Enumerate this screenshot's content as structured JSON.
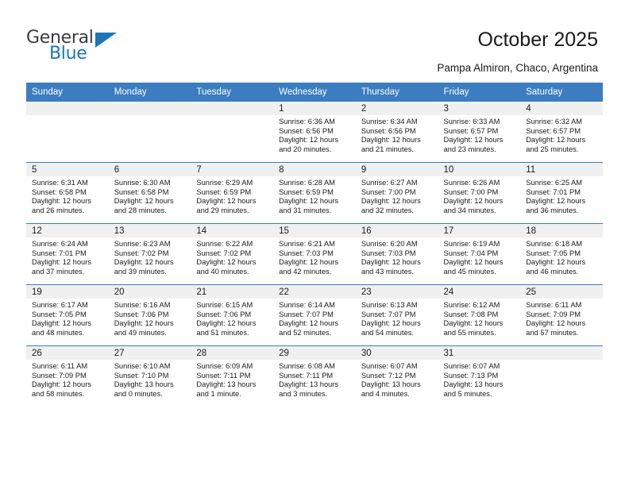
{
  "brand": {
    "name_part1": "General",
    "name_part2": "Blue",
    "accent_color": "#1b75bb"
  },
  "header": {
    "title": "October 2025",
    "subtitle": "Pampa Almiron, Chaco, Argentina"
  },
  "calendar": {
    "header_bg": "#3b7dc0",
    "daynum_bg": "#f0f0f0",
    "weekdays": [
      "Sunday",
      "Monday",
      "Tuesday",
      "Wednesday",
      "Thursday",
      "Friday",
      "Saturday"
    ],
    "weeks": [
      [
        {
          "day": "",
          "empty": true
        },
        {
          "day": "",
          "empty": true
        },
        {
          "day": "",
          "empty": true
        },
        {
          "day": "1",
          "sunrise": "Sunrise: 6:36 AM",
          "sunset": "Sunset: 6:56 PM",
          "daylight_line1": "Daylight: 12 hours",
          "daylight_line2": "and 20 minutes."
        },
        {
          "day": "2",
          "sunrise": "Sunrise: 6:34 AM",
          "sunset": "Sunset: 6:56 PM",
          "daylight_line1": "Daylight: 12 hours",
          "daylight_line2": "and 21 minutes."
        },
        {
          "day": "3",
          "sunrise": "Sunrise: 6:33 AM",
          "sunset": "Sunset: 6:57 PM",
          "daylight_line1": "Daylight: 12 hours",
          "daylight_line2": "and 23 minutes."
        },
        {
          "day": "4",
          "sunrise": "Sunrise: 6:32 AM",
          "sunset": "Sunset: 6:57 PM",
          "daylight_line1": "Daylight: 12 hours",
          "daylight_line2": "and 25 minutes."
        }
      ],
      [
        {
          "day": "5",
          "sunrise": "Sunrise: 6:31 AM",
          "sunset": "Sunset: 6:58 PM",
          "daylight_line1": "Daylight: 12 hours",
          "daylight_line2": "and 26 minutes."
        },
        {
          "day": "6",
          "sunrise": "Sunrise: 6:30 AM",
          "sunset": "Sunset: 6:58 PM",
          "daylight_line1": "Daylight: 12 hours",
          "daylight_line2": "and 28 minutes."
        },
        {
          "day": "7",
          "sunrise": "Sunrise: 6:29 AM",
          "sunset": "Sunset: 6:59 PM",
          "daylight_line1": "Daylight: 12 hours",
          "daylight_line2": "and 29 minutes."
        },
        {
          "day": "8",
          "sunrise": "Sunrise: 6:28 AM",
          "sunset": "Sunset: 6:59 PM",
          "daylight_line1": "Daylight: 12 hours",
          "daylight_line2": "and 31 minutes."
        },
        {
          "day": "9",
          "sunrise": "Sunrise: 6:27 AM",
          "sunset": "Sunset: 7:00 PM",
          "daylight_line1": "Daylight: 12 hours",
          "daylight_line2": "and 32 minutes."
        },
        {
          "day": "10",
          "sunrise": "Sunrise: 6:26 AM",
          "sunset": "Sunset: 7:00 PM",
          "daylight_line1": "Daylight: 12 hours",
          "daylight_line2": "and 34 minutes."
        },
        {
          "day": "11",
          "sunrise": "Sunrise: 6:25 AM",
          "sunset": "Sunset: 7:01 PM",
          "daylight_line1": "Daylight: 12 hours",
          "daylight_line2": "and 36 minutes."
        }
      ],
      [
        {
          "day": "12",
          "sunrise": "Sunrise: 6:24 AM",
          "sunset": "Sunset: 7:01 PM",
          "daylight_line1": "Daylight: 12 hours",
          "daylight_line2": "and 37 minutes."
        },
        {
          "day": "13",
          "sunrise": "Sunrise: 6:23 AM",
          "sunset": "Sunset: 7:02 PM",
          "daylight_line1": "Daylight: 12 hours",
          "daylight_line2": "and 39 minutes."
        },
        {
          "day": "14",
          "sunrise": "Sunrise: 6:22 AM",
          "sunset": "Sunset: 7:02 PM",
          "daylight_line1": "Daylight: 12 hours",
          "daylight_line2": "and 40 minutes."
        },
        {
          "day": "15",
          "sunrise": "Sunrise: 6:21 AM",
          "sunset": "Sunset: 7:03 PM",
          "daylight_line1": "Daylight: 12 hours",
          "daylight_line2": "and 42 minutes."
        },
        {
          "day": "16",
          "sunrise": "Sunrise: 6:20 AM",
          "sunset": "Sunset: 7:03 PM",
          "daylight_line1": "Daylight: 12 hours",
          "daylight_line2": "and 43 minutes."
        },
        {
          "day": "17",
          "sunrise": "Sunrise: 6:19 AM",
          "sunset": "Sunset: 7:04 PM",
          "daylight_line1": "Daylight: 12 hours",
          "daylight_line2": "and 45 minutes."
        },
        {
          "day": "18",
          "sunrise": "Sunrise: 6:18 AM",
          "sunset": "Sunset: 7:05 PM",
          "daylight_line1": "Daylight: 12 hours",
          "daylight_line2": "and 46 minutes."
        }
      ],
      [
        {
          "day": "19",
          "sunrise": "Sunrise: 6:17 AM",
          "sunset": "Sunset: 7:05 PM",
          "daylight_line1": "Daylight: 12 hours",
          "daylight_line2": "and 48 minutes."
        },
        {
          "day": "20",
          "sunrise": "Sunrise: 6:16 AM",
          "sunset": "Sunset: 7:06 PM",
          "daylight_line1": "Daylight: 12 hours",
          "daylight_line2": "and 49 minutes."
        },
        {
          "day": "21",
          "sunrise": "Sunrise: 6:15 AM",
          "sunset": "Sunset: 7:06 PM",
          "daylight_line1": "Daylight: 12 hours",
          "daylight_line2": "and 51 minutes."
        },
        {
          "day": "22",
          "sunrise": "Sunrise: 6:14 AM",
          "sunset": "Sunset: 7:07 PM",
          "daylight_line1": "Daylight: 12 hours",
          "daylight_line2": "and 52 minutes."
        },
        {
          "day": "23",
          "sunrise": "Sunrise: 6:13 AM",
          "sunset": "Sunset: 7:07 PM",
          "daylight_line1": "Daylight: 12 hours",
          "daylight_line2": "and 54 minutes."
        },
        {
          "day": "24",
          "sunrise": "Sunrise: 6:12 AM",
          "sunset": "Sunset: 7:08 PM",
          "daylight_line1": "Daylight: 12 hours",
          "daylight_line2": "and 55 minutes."
        },
        {
          "day": "25",
          "sunrise": "Sunrise: 6:11 AM",
          "sunset": "Sunset: 7:09 PM",
          "daylight_line1": "Daylight: 12 hours",
          "daylight_line2": "and 57 minutes."
        }
      ],
      [
        {
          "day": "26",
          "sunrise": "Sunrise: 6:11 AM",
          "sunset": "Sunset: 7:09 PM",
          "daylight_line1": "Daylight: 12 hours",
          "daylight_line2": "and 58 minutes."
        },
        {
          "day": "27",
          "sunrise": "Sunrise: 6:10 AM",
          "sunset": "Sunset: 7:10 PM",
          "daylight_line1": "Daylight: 13 hours",
          "daylight_line2": "and 0 minutes."
        },
        {
          "day": "28",
          "sunrise": "Sunrise: 6:09 AM",
          "sunset": "Sunset: 7:11 PM",
          "daylight_line1": "Daylight: 13 hours",
          "daylight_line2": "and 1 minute."
        },
        {
          "day": "29",
          "sunrise": "Sunrise: 6:08 AM",
          "sunset": "Sunset: 7:11 PM",
          "daylight_line1": "Daylight: 13 hours",
          "daylight_line2": "and 3 minutes."
        },
        {
          "day": "30",
          "sunrise": "Sunrise: 6:07 AM",
          "sunset": "Sunset: 7:12 PM",
          "daylight_line1": "Daylight: 13 hours",
          "daylight_line2": "and 4 minutes."
        },
        {
          "day": "31",
          "sunrise": "Sunrise: 6:07 AM",
          "sunset": "Sunset: 7:13 PM",
          "daylight_line1": "Daylight: 13 hours",
          "daylight_line2": "and 5 minutes."
        },
        {
          "day": "",
          "empty": true
        }
      ]
    ]
  }
}
